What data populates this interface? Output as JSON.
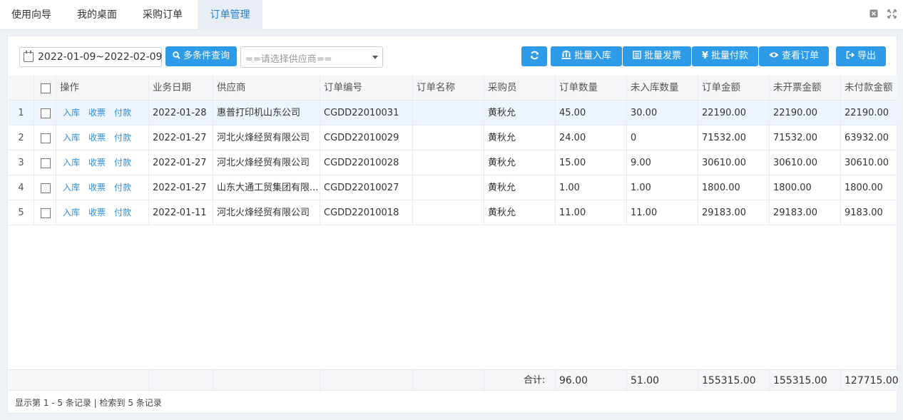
{
  "tabs": [
    {
      "label": "使用向导",
      "active": false
    },
    {
      "label": "我的桌面",
      "active": false
    },
    {
      "label": "采购订单",
      "active": false
    },
    {
      "label": "订单管理",
      "active": true
    }
  ],
  "toolbar": {
    "date_range": "2022-01-09~2022-02-09",
    "multi_search_label": "多条件查询",
    "supplier_placeholder": "==请选择供应商==",
    "batch_inbound_label": "批量入库",
    "batch_invoice_label": "批量发票",
    "batch_payment_label": "批量付款",
    "view_order_label": "查看订单",
    "export_label": "导出"
  },
  "table": {
    "headers": {
      "ops": "操作",
      "date": "业务日期",
      "supplier": "供应商",
      "order_no": "订单编号",
      "order_name": "订单名称",
      "buyer": "采购员",
      "qty": "订单数量",
      "not_in": "未入库数量",
      "amount": "订单金额",
      "uninvoiced": "未开票金额",
      "unpaid": "未付款金额"
    },
    "row_actions": {
      "inbound": "入库",
      "receipt": "收票",
      "pay": "付款"
    },
    "rows": [
      {
        "num": "1",
        "date": "2022-01-28",
        "supplier": "惠普打印机山东公司",
        "order_no": "CGDD22010031",
        "order_name": "",
        "buyer": "黄秋允",
        "qty": "45.00",
        "not_in": "30.00",
        "amount": "22190.00",
        "uninvoiced": "22190.00",
        "unpaid": "22190.00"
      },
      {
        "num": "2",
        "date": "2022-01-27",
        "supplier": "河北火烽经贸有限公司",
        "order_no": "CGDD22010029",
        "order_name": "",
        "buyer": "黄秋允",
        "qty": "24.00",
        "not_in": "0",
        "amount": "71532.00",
        "uninvoiced": "71532.00",
        "unpaid": "63932.00"
      },
      {
        "num": "3",
        "date": "2022-01-27",
        "supplier": "河北火烽经贸有限公司",
        "order_no": "CGDD22010028",
        "order_name": "",
        "buyer": "黄秋允",
        "qty": "15.00",
        "not_in": "9.00",
        "amount": "30610.00",
        "uninvoiced": "30610.00",
        "unpaid": "30610.00"
      },
      {
        "num": "4",
        "date": "2022-01-27",
        "supplier": "山东大通工贸集团有限...",
        "order_no": "CGDD22010027",
        "order_name": "",
        "buyer": "黄秋允",
        "qty": "1.00",
        "not_in": "1.00",
        "amount": "1800.00",
        "uninvoiced": "1800.00",
        "unpaid": "1800.00"
      },
      {
        "num": "5",
        "date": "2022-01-11",
        "supplier": "河北火烽经贸有限公司",
        "order_no": "CGDD22010018",
        "order_name": "",
        "buyer": "黄秋允",
        "qty": "11.00",
        "not_in": "11.00",
        "amount": "29183.00",
        "uninvoiced": "29183.00",
        "unpaid": "9183.00"
      }
    ],
    "totals": {
      "label": "合计:",
      "qty": "96.00",
      "not_in": "51.00",
      "amount": "155315.00",
      "uninvoiced": "155315.00",
      "unpaid": "127715.00"
    }
  },
  "status": "显示第 1 - 5 条记录 | 检索到 5 条记录",
  "colors": {
    "accent": "#2e9be8",
    "link": "#2e8fe0",
    "active_tab_bg": "#e9eef5"
  }
}
